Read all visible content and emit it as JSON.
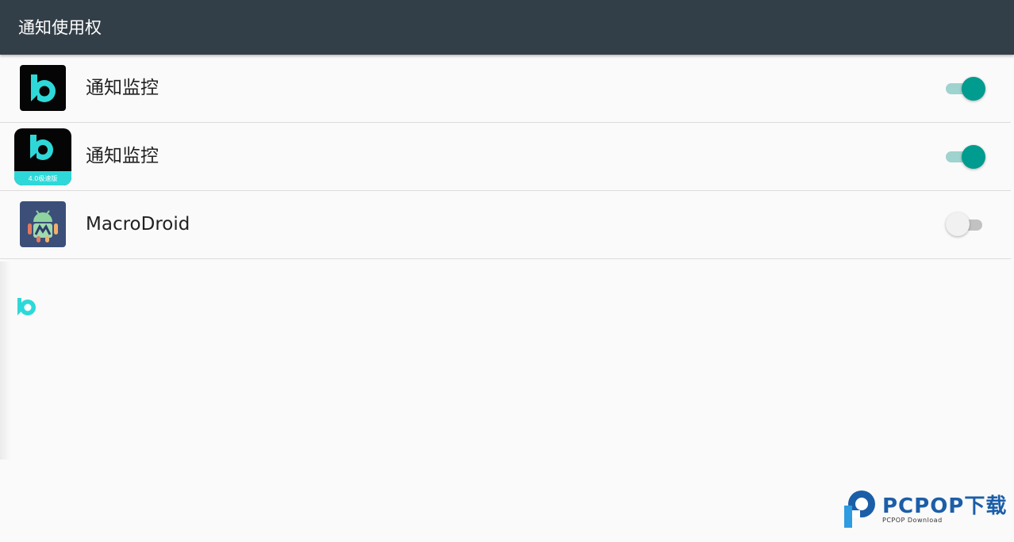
{
  "app_bar": {
    "title": "通知使用权"
  },
  "apps": [
    {
      "label": "通知监控",
      "icon": "b-logo-icon",
      "enabled": true
    },
    {
      "label": "通知监控",
      "icon": "b-logo-speed-icon",
      "badge": "4.0极速版",
      "enabled": true
    },
    {
      "label": "MacroDroid",
      "icon": "macrodroid-icon",
      "enabled": false
    }
  ],
  "watermark": {
    "brand": "PCPOP下载",
    "sub": "PCPOP Download"
  },
  "colors": {
    "appbar": "#333f48",
    "accent": "#009c8f",
    "accent_track": "#9fd3cf",
    "logo_cyan": "#2fd8d8"
  }
}
